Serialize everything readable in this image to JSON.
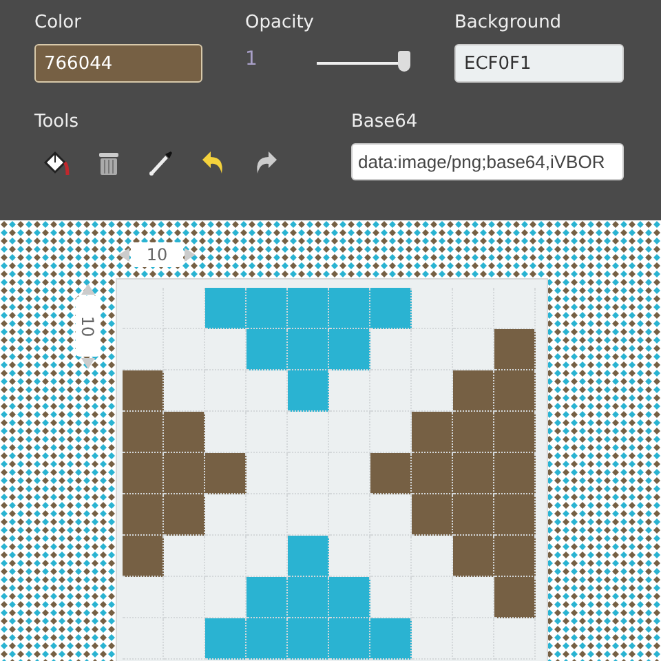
{
  "color_field": {
    "label": "Color",
    "value": "766044"
  },
  "opacity": {
    "label": "Opacity",
    "reading": "1",
    "level": 1
  },
  "background_field": {
    "label": "Background",
    "value": "ECF0F1"
  },
  "tools": {
    "label": "Tools"
  },
  "base64_field": {
    "label": "Base64",
    "value": "data:image/png;base64,iVBOR"
  },
  "canvas": {
    "width_reading": "10",
    "height_reading": "10",
    "rows": [
      {
        "cells": [
          {
            "color": "#ecf0f1"
          },
          {
            "color": "#ecf0f1"
          },
          {
            "color": "#2ab3d2"
          },
          {
            "color": "#2ab3d2"
          },
          {
            "color": "#2ab3d2"
          },
          {
            "color": "#2ab3d2"
          },
          {
            "color": "#2ab3d2"
          },
          {
            "color": "#ecf0f1"
          },
          {
            "color": "#ecf0f1"
          },
          {
            "color": "#ecf0f1"
          }
        ]
      },
      {
        "cells": [
          {
            "color": "#ecf0f1"
          },
          {
            "color": "#ecf0f1"
          },
          {
            "color": "#ecf0f1"
          },
          {
            "color": "#2ab3d2"
          },
          {
            "color": "#2ab3d2"
          },
          {
            "color": "#2ab3d2"
          },
          {
            "color": "#ecf0f1"
          },
          {
            "color": "#ecf0f1"
          },
          {
            "color": "#ecf0f1"
          },
          {
            "color": "#766044"
          }
        ]
      },
      {
        "cells": [
          {
            "color": "#766044"
          },
          {
            "color": "#ecf0f1"
          },
          {
            "color": "#ecf0f1"
          },
          {
            "color": "#ecf0f1"
          },
          {
            "color": "#2ab3d2"
          },
          {
            "color": "#ecf0f1"
          },
          {
            "color": "#ecf0f1"
          },
          {
            "color": "#ecf0f1"
          },
          {
            "color": "#766044"
          },
          {
            "color": "#766044"
          }
        ]
      },
      {
        "cells": [
          {
            "color": "#766044"
          },
          {
            "color": "#766044"
          },
          {
            "color": "#ecf0f1"
          },
          {
            "color": "#ecf0f1"
          },
          {
            "color": "#ecf0f1"
          },
          {
            "color": "#ecf0f1"
          },
          {
            "color": "#ecf0f1"
          },
          {
            "color": "#766044"
          },
          {
            "color": "#766044"
          },
          {
            "color": "#766044"
          }
        ]
      },
      {
        "cells": [
          {
            "color": "#766044"
          },
          {
            "color": "#766044"
          },
          {
            "color": "#766044"
          },
          {
            "color": "#ecf0f1"
          },
          {
            "color": "#ecf0f1"
          },
          {
            "color": "#ecf0f1"
          },
          {
            "color": "#766044"
          },
          {
            "color": "#766044"
          },
          {
            "color": "#766044"
          },
          {
            "color": "#766044"
          }
        ]
      },
      {
        "cells": [
          {
            "color": "#766044"
          },
          {
            "color": "#766044"
          },
          {
            "color": "#ecf0f1"
          },
          {
            "color": "#ecf0f1"
          },
          {
            "color": "#ecf0f1"
          },
          {
            "color": "#ecf0f1"
          },
          {
            "color": "#ecf0f1"
          },
          {
            "color": "#766044"
          },
          {
            "color": "#766044"
          },
          {
            "color": "#766044"
          }
        ]
      },
      {
        "cells": [
          {
            "color": "#766044"
          },
          {
            "color": "#ecf0f1"
          },
          {
            "color": "#ecf0f1"
          },
          {
            "color": "#ecf0f1"
          },
          {
            "color": "#2ab3d2"
          },
          {
            "color": "#ecf0f1"
          },
          {
            "color": "#ecf0f1"
          },
          {
            "color": "#ecf0f1"
          },
          {
            "color": "#766044"
          },
          {
            "color": "#766044"
          }
        ]
      },
      {
        "cells": [
          {
            "color": "#ecf0f1"
          },
          {
            "color": "#ecf0f1"
          },
          {
            "color": "#ecf0f1"
          },
          {
            "color": "#2ab3d2"
          },
          {
            "color": "#2ab3d2"
          },
          {
            "color": "#2ab3d2"
          },
          {
            "color": "#ecf0f1"
          },
          {
            "color": "#ecf0f1"
          },
          {
            "color": "#ecf0f1"
          },
          {
            "color": "#766044"
          }
        ]
      },
      {
        "cells": [
          {
            "color": "#ecf0f1"
          },
          {
            "color": "#ecf0f1"
          },
          {
            "color": "#2ab3d2"
          },
          {
            "color": "#2ab3d2"
          },
          {
            "color": "#2ab3d2"
          },
          {
            "color": "#2ab3d2"
          },
          {
            "color": "#2ab3d2"
          },
          {
            "color": "#ecf0f1"
          },
          {
            "color": "#ecf0f1"
          },
          {
            "color": "#ecf0f1"
          }
        ]
      }
    ]
  }
}
